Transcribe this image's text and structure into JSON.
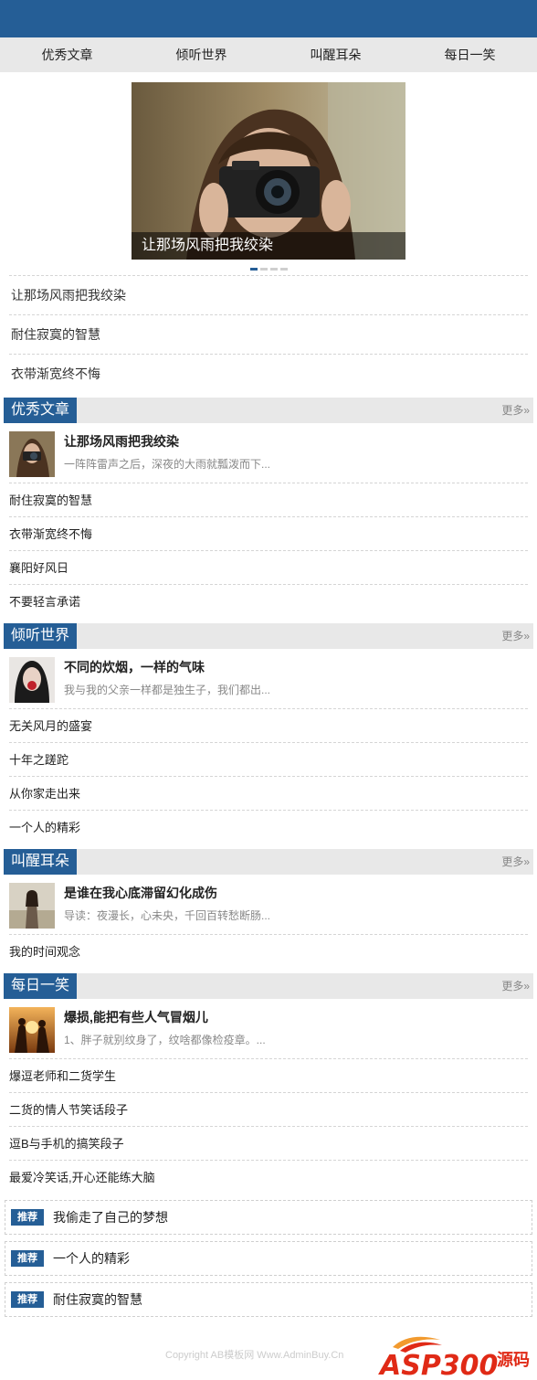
{
  "nav": [
    "优秀文章",
    "倾听世界",
    "叫醒耳朵",
    "每日一笑"
  ],
  "slider": {
    "caption": "让那场风雨把我绞染",
    "slide_count": 4,
    "active_index": 0
  },
  "hot_list": [
    "让那场风雨把我绞染",
    "耐住寂寞的智慧",
    "衣带渐宽终不悔"
  ],
  "sections": [
    {
      "title": "优秀文章",
      "more": "更多»",
      "featured": {
        "title": "让那场风雨把我绞染",
        "summary": "一阵阵雷声之后，深夜的大雨就瓢泼而下..."
      },
      "items": [
        "耐住寂寞的智慧",
        "衣带渐宽终不悔",
        "襄阳好风日",
        "不要轻言承诺"
      ]
    },
    {
      "title": "倾听世界",
      "more": "更多»",
      "featured": {
        "title": "不同的炊烟，一样的气味",
        "summary": "我与我的父亲一样都是独生子，我们都出..."
      },
      "items": [
        "无关风月的盛宴",
        "十年之蹉跎",
        "从你家走出来",
        "一个人的精彩"
      ]
    },
    {
      "title": "叫醒耳朵",
      "more": "更多»",
      "featured": {
        "title": "是谁在我心底滞留幻化成伤",
        "summary": "导读：夜漫长，心未央，千回百转愁断肠..."
      },
      "items": [
        "我的时间观念"
      ]
    },
    {
      "title": "每日一笑",
      "more": "更多»",
      "featured": {
        "title": "爆损,能把有些人气冒烟儿",
        "summary": "1、胖子就别纹身了，纹啥都像检疫章。..."
      },
      "items": [
        "爆逗老师和二货学生",
        "二货的情人节笑话段子",
        "逗B与手机的搞笑段子",
        "最爱冷笑话,开心还能练大脑"
      ]
    }
  ],
  "recommend": {
    "badge": "推荐",
    "items": [
      "我偷走了自己的梦想",
      "一个人的精彩",
      "耐住寂寞的智慧"
    ]
  },
  "footer": {
    "copyright": "Copyright AB模板网 Www.AdminBuy.Cn",
    "logo_text": "ASP300",
    "logo_suffix": "源码"
  },
  "colors": {
    "brand": "#255e96",
    "nav_bg": "#e8e8e8",
    "logo_red": "#e02a16"
  }
}
